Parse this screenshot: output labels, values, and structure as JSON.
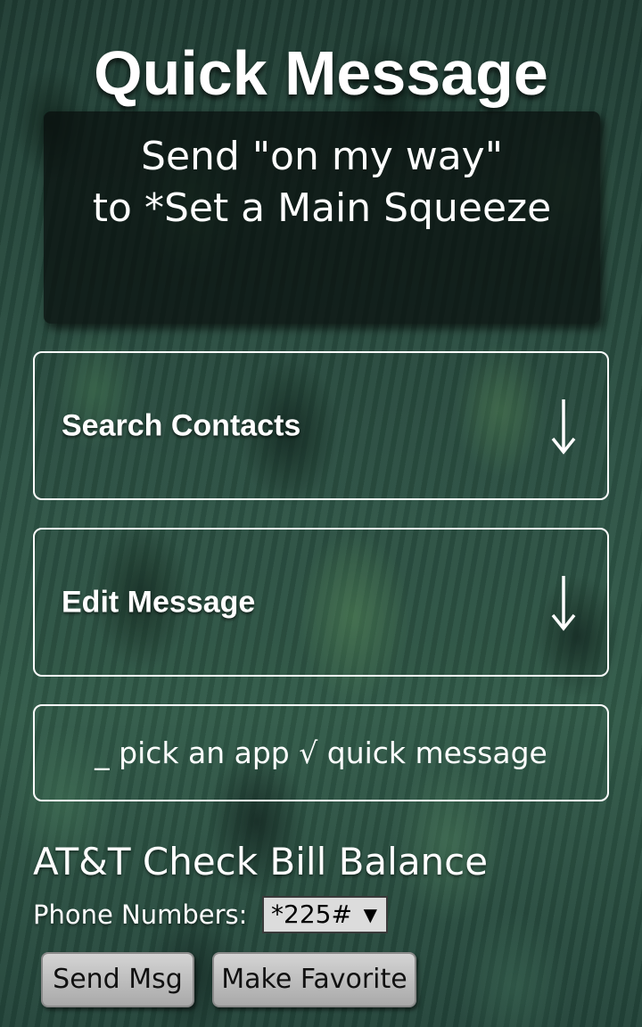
{
  "header": {
    "title": "Quick Message"
  },
  "preview": {
    "line1": "Send \"on my way\"",
    "line2": "to *Set a Main Squeeze"
  },
  "panels": {
    "search_contacts": {
      "label": "Search Contacts",
      "icon": "arrow-down-icon"
    },
    "edit_message": {
      "label": "Edit Message",
      "icon": "arrow-down-icon"
    }
  },
  "app_picker": {
    "text": "_ pick an app √ quick message"
  },
  "carrier": {
    "title": "AT&T Check Bill Balance",
    "phone_label": "Phone Numbers:",
    "phone_selected": "*225#",
    "select_icon": "triangle-down-icon"
  },
  "actions": {
    "send_label": "Send Msg",
    "favorite_label": "Make Favorite"
  },
  "colors": {
    "text": "#ffffff",
    "button_bg": "#c0c0c0",
    "select_bg": "#dcdcdc"
  }
}
